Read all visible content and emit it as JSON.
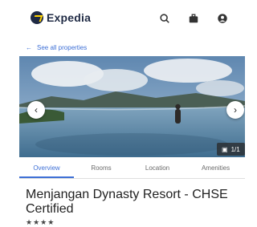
{
  "app": {
    "brand": "Expedia"
  },
  "toolbar": {
    "search_icon": "search-icon",
    "trips_icon": "briefcase-icon",
    "account_icon": "account-icon"
  },
  "navigation": {
    "back_label": "See all properties"
  },
  "gallery": {
    "counter": "1/1",
    "prev_icon": "chevron-left-icon",
    "next_icon": "chevron-right-icon"
  },
  "tabs": [
    {
      "label": "Overview",
      "active": true
    },
    {
      "label": "Rooms",
      "active": false
    },
    {
      "label": "Location",
      "active": false
    },
    {
      "label": "Amenities",
      "active": false
    }
  ],
  "property": {
    "title": "Menjangan Dynasty Resort - CHSE Certified",
    "star_rating": 4,
    "stars_text": "★★★★"
  },
  "colors": {
    "brand": "#1f2a44",
    "accent": "#3d6fd6",
    "logo_mark": "#ffd200"
  }
}
